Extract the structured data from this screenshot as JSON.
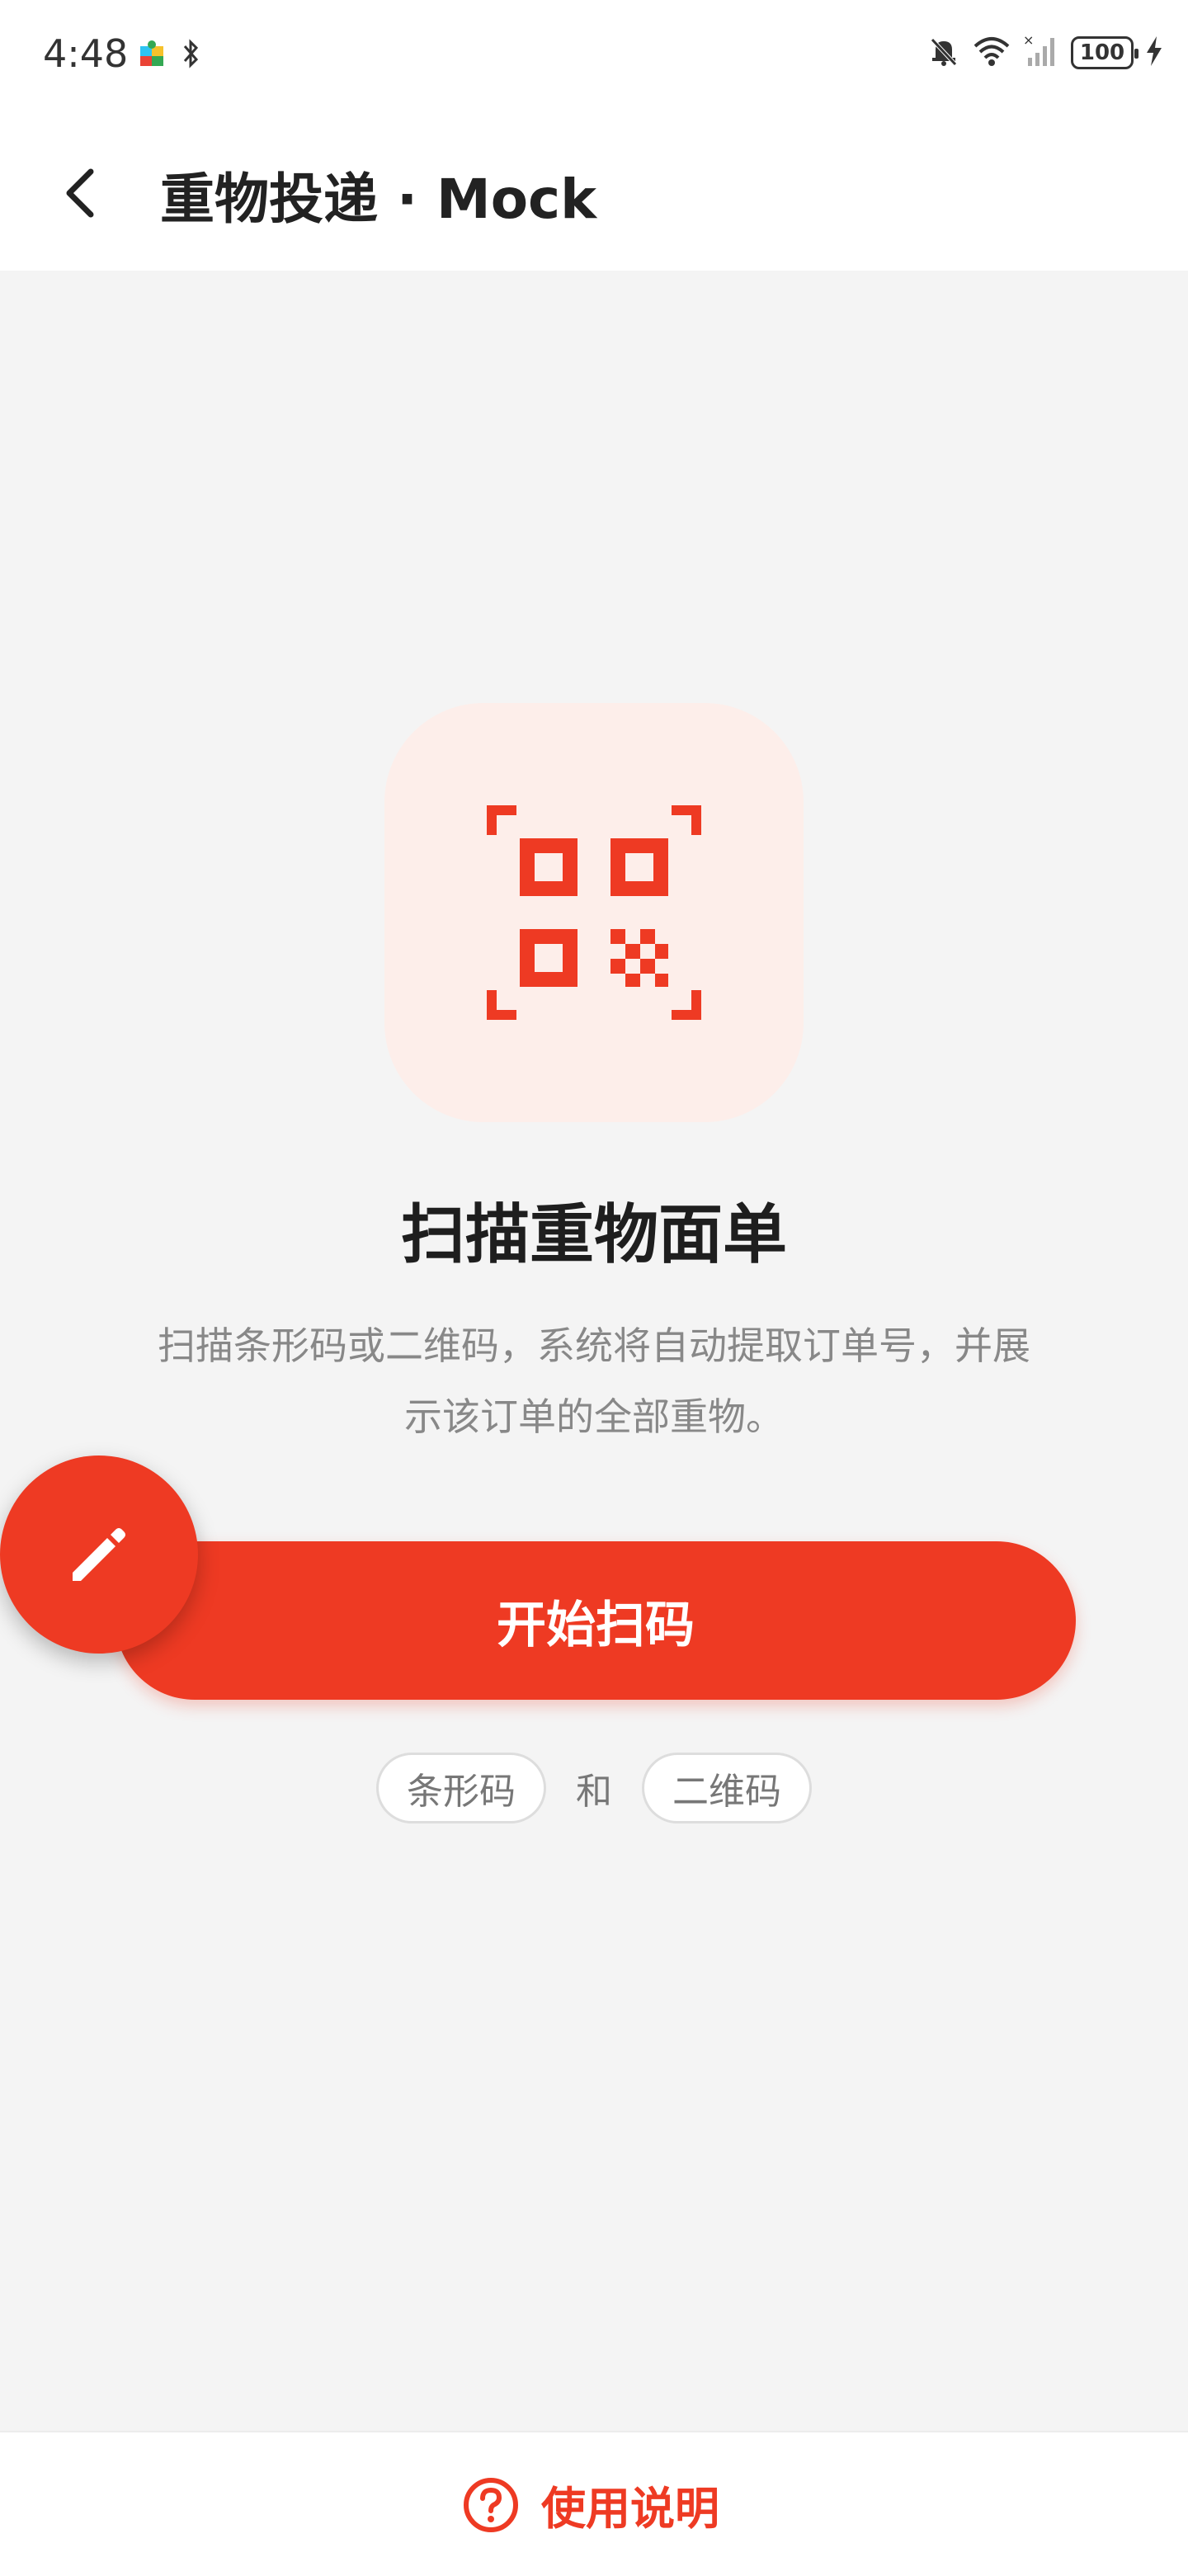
{
  "status_bar": {
    "time": "4:48",
    "battery": "100"
  },
  "header": {
    "title": "重物投递 · Mock"
  },
  "main": {
    "headline": "扫描重物面单",
    "description_line1": "扫描条形码或二维码，系统将自动提取订单号，并展",
    "description_line2": "示该订单的全部重物。",
    "scan_button_label": "开始扫码",
    "chips": {
      "barcode": "条形码",
      "separator": "和",
      "qrcode": "二维码"
    }
  },
  "footer": {
    "help_label": "使用说明"
  },
  "colors": {
    "accent": "#ee3a23",
    "tile": "#fdeeea",
    "background": "#f4f4f4"
  }
}
